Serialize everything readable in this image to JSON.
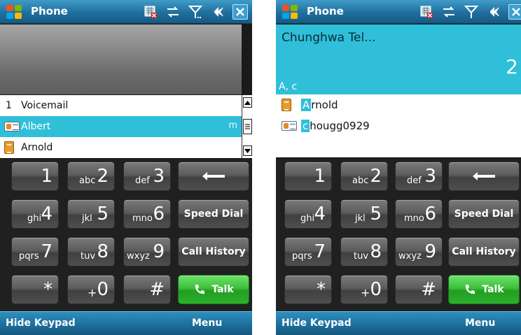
{
  "left": {
    "title": "Phone",
    "list": [
      {
        "num": "1",
        "icon": "",
        "label": "Voicemail",
        "extra": "",
        "selected": false
      },
      {
        "num": "",
        "icon": "contact-card-icon",
        "label": "Albert",
        "extra": "m",
        "selected": true
      },
      {
        "num": "",
        "icon": "sim-contact-icon",
        "label": "Arnold",
        "extra": "",
        "selected": false
      }
    ],
    "softkeys": {
      "left": "Hide Keypad",
      "right": "Menu"
    }
  },
  "right": {
    "title": "Phone",
    "carrier": "Chunghwa Tel...",
    "entry": "2",
    "letters": "A, c",
    "matches": [
      {
        "icon": "sim-contact-icon",
        "hl": "A",
        "rest": "rnold"
      },
      {
        "icon": "contact-card-icon",
        "hl": "c",
        "rest": "hougg0929"
      }
    ],
    "softkeys": {
      "left": "Hide Keypad",
      "right": "Menu"
    }
  },
  "keypad": {
    "keys": [
      {
        "id": "key-1",
        "num": "1",
        "sub": ""
      },
      {
        "id": "key-2",
        "num": "2",
        "sub": "abc"
      },
      {
        "id": "key-3",
        "num": "3",
        "sub": "def"
      },
      {
        "id": "key-backspace",
        "num": "",
        "sub": "",
        "icon": "backspace-icon"
      },
      {
        "id": "key-4",
        "num": "4",
        "sub": "ghi"
      },
      {
        "id": "key-5",
        "num": "5",
        "sub": "jkl"
      },
      {
        "id": "key-6",
        "num": "6",
        "sub": "mno"
      },
      {
        "id": "key-speed-dial",
        "label": "Speed Dial"
      },
      {
        "id": "key-7",
        "num": "7",
        "sub": "pqrs"
      },
      {
        "id": "key-8",
        "num": "8",
        "sub": "tuv"
      },
      {
        "id": "key-9",
        "num": "9",
        "sub": "wxyz"
      },
      {
        "id": "key-call-history",
        "label": "Call History"
      },
      {
        "id": "key-star",
        "num": "*",
        "sub": ""
      },
      {
        "id": "key-0",
        "num": "0",
        "sub": "+"
      },
      {
        "id": "key-hash",
        "num": "#",
        "sub": ""
      },
      {
        "id": "key-talk",
        "label": "Talk",
        "icon": "phone-icon"
      }
    ]
  },
  "colors": {
    "highlight": "#2fbfd9",
    "titlebar": "#1f6f9e",
    "talk": "#3cbf3a"
  }
}
